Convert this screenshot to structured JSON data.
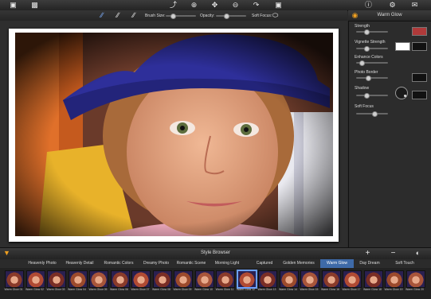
{
  "toolbar": {
    "icons": [
      "crop-icon",
      "export-icon",
      "brush-icon",
      "zoom-in-icon",
      "move-icon",
      "zoom-out-icon",
      "redo-icon",
      "fit-icon",
      "info-icon",
      "settings-icon",
      "share-icon"
    ]
  },
  "brushbar": {
    "brush_size_label": "Brush Size:",
    "opacity_label": "Opacity:",
    "soft_focus_label": "Soft Focus:"
  },
  "panel": {
    "title": "Warm Glow",
    "strength_label": "Strength",
    "vignette_label": "Vignette Strength",
    "enhance_label": "Enhance Colors",
    "border_label": "Photo Border",
    "shadow_label": "Shadow",
    "softfocus_label": "Soft Focus",
    "colors": {
      "strength": "#b03a3a",
      "vignette_a": "#ffffff",
      "vignette_b": "#111111",
      "border": "#111111",
      "shadow": "#111111"
    },
    "levels": {
      "strength": 0.25,
      "vignette": 0.25,
      "enhance": 0.1,
      "border": 0.3,
      "softfocus": 0.45
    }
  },
  "browser": {
    "title": "Style Browser",
    "tabs": [
      "Heavenly Photo",
      "Heavenly Detail",
      "Romantic Colors",
      "Dreamy Photo",
      "Romantic Scene",
      "Morning Light",
      "Captured Moments",
      "Golden Memories",
      "Warm Glow",
      "Day Dream",
      "Soft Touch"
    ],
    "active_tab": "Warm Glow",
    "thumbs": [
      "Warm Glow 01",
      "Warm Glow 02",
      "Warm Glow 03",
      "Warm Glow 04",
      "Warm Glow 05",
      "Warm Glow 06",
      "Warm Glow 07",
      "Warm Glow 08",
      "Warm Glow 09",
      "Warm Glow 10",
      "Warm Glow 11",
      "Warm Glow 12",
      "Warm Glow 13",
      "Warm Glow 14",
      "Warm Glow 15",
      "Warm Glow 16",
      "Warm Glow 17",
      "Warm Glow 18",
      "Warm Glow 19",
      "Warm Glow 20"
    ],
    "selected_thumb": "Warm Glow 12"
  }
}
